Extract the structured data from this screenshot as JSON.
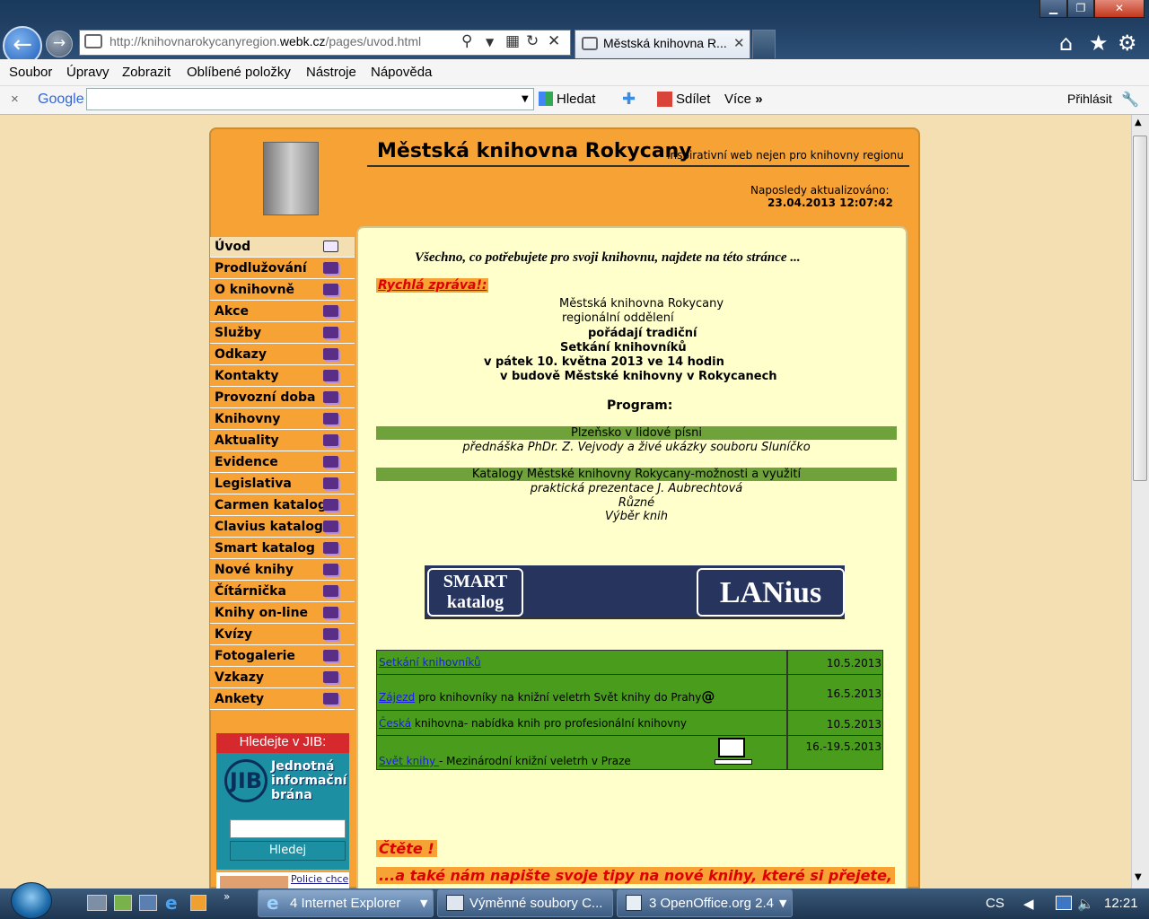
{
  "browser": {
    "window_controls": {
      "minimize": "▁",
      "maximize": "❐",
      "close": "✕"
    },
    "url_prefix": "http://knihovnarokycanyregion.",
    "url_domain": "webk.cz",
    "url_path": "/pages/uvod.html",
    "tab_title": "Městská knihovna R...",
    "menu": [
      "Soubor",
      "Úpravy",
      "Zobrazit",
      "Oblíbené položky",
      "Nástroje",
      "Nápověda"
    ],
    "google_toolbar": {
      "close": "×",
      "logo": "Google",
      "search_value": "",
      "search_button": "Hledat",
      "share": "Sdílet",
      "more": "Více",
      "more_glyph": "»",
      "signin": "Přihlásit"
    }
  },
  "site": {
    "title": "Městská knihovna Rokycany",
    "tagline": "- inspirativní web nejen pro knihovny regionu",
    "updated_label": "Naposledy aktualizováno:",
    "updated_value": "23.04.2013 12:07:42"
  },
  "nav": [
    "Úvod",
    "Prodlužování",
    "O knihovně",
    "Akce",
    "Služby",
    "Odkazy",
    "Kontakty",
    "Provozní doba",
    "Knihovny",
    "Aktuality",
    "Evidence",
    "Legislativa",
    "Carmen katalog",
    "Clavius katalog",
    "Smart katalog",
    "Nové knihy",
    "Čítárnička",
    "Knihy on-line",
    "Kvízy",
    "Fotogalerie",
    "Vzkazy",
    "Ankety"
  ],
  "jib": {
    "header": "Hledejte v JIB:",
    "logo": "JIB",
    "name_line1": "Jednotná",
    "name_line2": "informační",
    "name_line3": "brána",
    "button": "Hledej",
    "police_link": "Policie chce"
  },
  "content": {
    "intro": "Všechno, co potřebujete pro svoji knihovnu, najdete na této stránce ...",
    "quick_label": "Rychlá zpráva!:",
    "msg": [
      "Městská knihovna Rokycany",
      "regionální oddělení",
      "pořádají tradiční",
      "Setkání knihovníků",
      "v pátek 10. května 2013 ve 14  hodin",
      "v budově Městské knihovny v Rokycanech"
    ],
    "program_label": "Program:",
    "program": [
      {
        "title": "Plzeňsko v lidové písni",
        "desc": "přednáška PhDr.  Z. Vejvody a živé  ukázky souboru Sluníčko"
      },
      {
        "title": "Katalogy Městské knihovny Rokycany-možnosti a využití",
        "desc": "praktická prezentace J. Aubrechtová"
      }
    ],
    "extra": [
      "Různé",
      "Výběr knih"
    ],
    "banner_smart_line1": "SMART",
    "banner_smart_line2": "katalog",
    "banner_lanius": "LANius",
    "events": [
      {
        "link": "Setkání knihovníků",
        "text": "",
        "at": "",
        "date": "10.5.2013"
      },
      {
        "link": "Zájezd",
        "text": " pro knihovníky na knižní veletrh Svět knihy do Prahy",
        "at": "@",
        "date": "16.5.2013"
      },
      {
        "link": "Česká",
        "text": " knihovna- nabídka knih  pro profesionální knihovny",
        "at": "",
        "date": "10.5.2013"
      },
      {
        "link": "Svět knihy ",
        "text": "- Mezinárodní knižní veletrh v Praze",
        "at": "",
        "date": "16.-19.5.2013"
      }
    ],
    "read": "Čtěte !",
    "write": "...a také nám napište svoje tipy na nové knihy, které si přejete,"
  },
  "taskbar": {
    "tasks": [
      "4 Internet Explorer",
      "Výměnné soubory C...",
      "3 OpenOffice.org 2.4"
    ],
    "lang": "CS",
    "clock": "12:21"
  }
}
